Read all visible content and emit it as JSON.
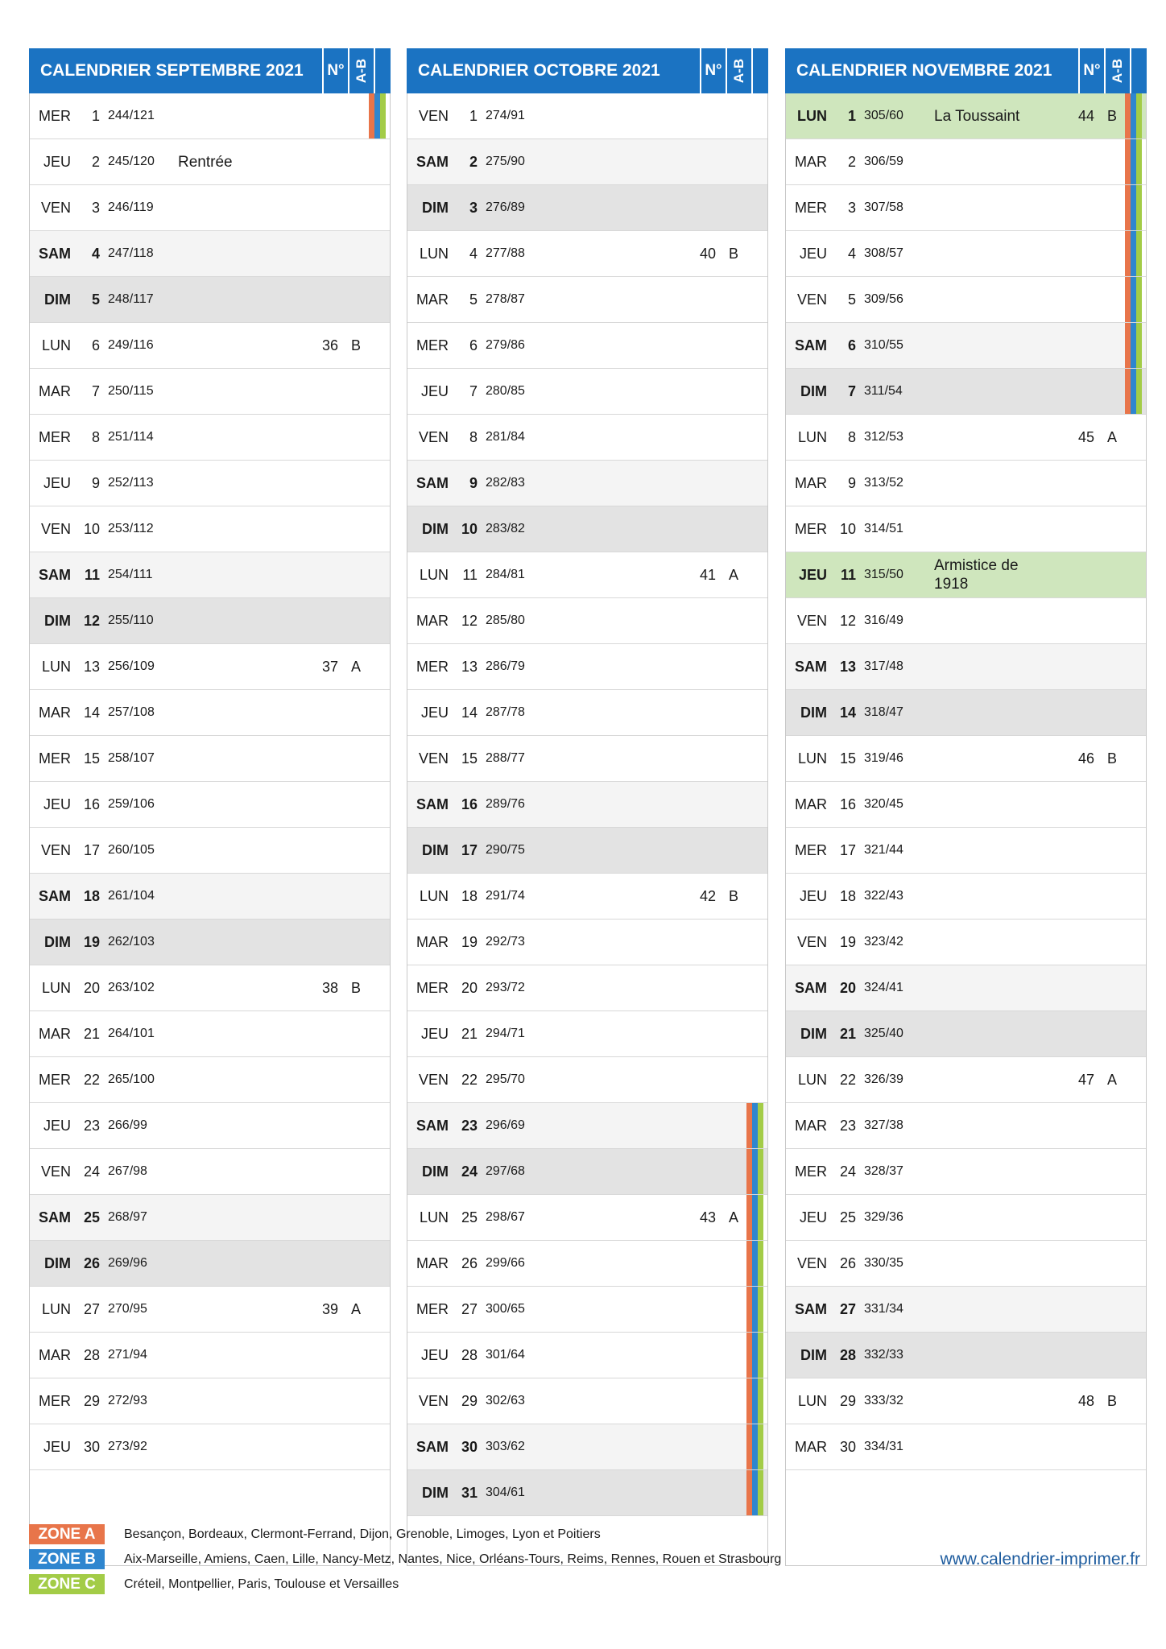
{
  "header_n": "N°",
  "header_ab": "A-B",
  "colors": {
    "zone_a": "#e8754a",
    "zone_b": "#2f86cf",
    "zone_c": "#a3cc47",
    "header_bg": "#1b73c2"
  },
  "months": [
    {
      "title": "CALENDRIER SEPTEMBRE 2021",
      "days": [
        {
          "dn": "MER",
          "d": "1",
          "doy": "244/121",
          "ev": "",
          "wn": "",
          "ab": "",
          "zones": [
            "a",
            "b",
            "c"
          ]
        },
        {
          "dn": "JEU",
          "d": "2",
          "doy": "245/120",
          "ev": "Rentrée",
          "wn": "",
          "ab": ""
        },
        {
          "dn": "VEN",
          "d": "3",
          "doy": "246/119",
          "ev": "",
          "wn": "",
          "ab": ""
        },
        {
          "dn": "SAM",
          "d": "4",
          "doy": "247/118",
          "ev": "",
          "wn": "",
          "ab": ""
        },
        {
          "dn": "DIM",
          "d": "5",
          "doy": "248/117",
          "ev": "",
          "wn": "",
          "ab": ""
        },
        {
          "dn": "LUN",
          "d": "6",
          "doy": "249/116",
          "ev": "",
          "wn": "36",
          "ab": "B"
        },
        {
          "dn": "MAR",
          "d": "7",
          "doy": "250/115",
          "ev": "",
          "wn": "",
          "ab": ""
        },
        {
          "dn": "MER",
          "d": "8",
          "doy": "251/114",
          "ev": "",
          "wn": "",
          "ab": ""
        },
        {
          "dn": "JEU",
          "d": "9",
          "doy": "252/113",
          "ev": "",
          "wn": "",
          "ab": ""
        },
        {
          "dn": "VEN",
          "d": "10",
          "doy": "253/112",
          "ev": "",
          "wn": "",
          "ab": ""
        },
        {
          "dn": "SAM",
          "d": "11",
          "doy": "254/111",
          "ev": "",
          "wn": "",
          "ab": ""
        },
        {
          "dn": "DIM",
          "d": "12",
          "doy": "255/110",
          "ev": "",
          "wn": "",
          "ab": ""
        },
        {
          "dn": "LUN",
          "d": "13",
          "doy": "256/109",
          "ev": "",
          "wn": "37",
          "ab": "A"
        },
        {
          "dn": "MAR",
          "d": "14",
          "doy": "257/108",
          "ev": "",
          "wn": "",
          "ab": ""
        },
        {
          "dn": "MER",
          "d": "15",
          "doy": "258/107",
          "ev": "",
          "wn": "",
          "ab": ""
        },
        {
          "dn": "JEU",
          "d": "16",
          "doy": "259/106",
          "ev": "",
          "wn": "",
          "ab": ""
        },
        {
          "dn": "VEN",
          "d": "17",
          "doy": "260/105",
          "ev": "",
          "wn": "",
          "ab": ""
        },
        {
          "dn": "SAM",
          "d": "18",
          "doy": "261/104",
          "ev": "",
          "wn": "",
          "ab": ""
        },
        {
          "dn": "DIM",
          "d": "19",
          "doy": "262/103",
          "ev": "",
          "wn": "",
          "ab": ""
        },
        {
          "dn": "LUN",
          "d": "20",
          "doy": "263/102",
          "ev": "",
          "wn": "38",
          "ab": "B"
        },
        {
          "dn": "MAR",
          "d": "21",
          "doy": "264/101",
          "ev": "",
          "wn": "",
          "ab": ""
        },
        {
          "dn": "MER",
          "d": "22",
          "doy": "265/100",
          "ev": "",
          "wn": "",
          "ab": ""
        },
        {
          "dn": "JEU",
          "d": "23",
          "doy": "266/99",
          "ev": "",
          "wn": "",
          "ab": ""
        },
        {
          "dn": "VEN",
          "d": "24",
          "doy": "267/98",
          "ev": "",
          "wn": "",
          "ab": ""
        },
        {
          "dn": "SAM",
          "d": "25",
          "doy": "268/97",
          "ev": "",
          "wn": "",
          "ab": ""
        },
        {
          "dn": "DIM",
          "d": "26",
          "doy": "269/96",
          "ev": "",
          "wn": "",
          "ab": ""
        },
        {
          "dn": "LUN",
          "d": "27",
          "doy": "270/95",
          "ev": "",
          "wn": "39",
          "ab": "A"
        },
        {
          "dn": "MAR",
          "d": "28",
          "doy": "271/94",
          "ev": "",
          "wn": "",
          "ab": ""
        },
        {
          "dn": "MER",
          "d": "29",
          "doy": "272/93",
          "ev": "",
          "wn": "",
          "ab": ""
        },
        {
          "dn": "JEU",
          "d": "30",
          "doy": "273/92",
          "ev": "",
          "wn": "",
          "ab": ""
        }
      ]
    },
    {
      "title": "CALENDRIER OCTOBRE 2021",
      "days": [
        {
          "dn": "VEN",
          "d": "1",
          "doy": "274/91",
          "ev": "",
          "wn": "",
          "ab": ""
        },
        {
          "dn": "SAM",
          "d": "2",
          "doy": "275/90",
          "ev": "",
          "wn": "",
          "ab": ""
        },
        {
          "dn": "DIM",
          "d": "3",
          "doy": "276/89",
          "ev": "",
          "wn": "",
          "ab": ""
        },
        {
          "dn": "LUN",
          "d": "4",
          "doy": "277/88",
          "ev": "",
          "wn": "40",
          "ab": "B"
        },
        {
          "dn": "MAR",
          "d": "5",
          "doy": "278/87",
          "ev": "",
          "wn": "",
          "ab": ""
        },
        {
          "dn": "MER",
          "d": "6",
          "doy": "279/86",
          "ev": "",
          "wn": "",
          "ab": ""
        },
        {
          "dn": "JEU",
          "d": "7",
          "doy": "280/85",
          "ev": "",
          "wn": "",
          "ab": ""
        },
        {
          "dn": "VEN",
          "d": "8",
          "doy": "281/84",
          "ev": "",
          "wn": "",
          "ab": ""
        },
        {
          "dn": "SAM",
          "d": "9",
          "doy": "282/83",
          "ev": "",
          "wn": "",
          "ab": ""
        },
        {
          "dn": "DIM",
          "d": "10",
          "doy": "283/82",
          "ev": "",
          "wn": "",
          "ab": ""
        },
        {
          "dn": "LUN",
          "d": "11",
          "doy": "284/81",
          "ev": "",
          "wn": "41",
          "ab": "A"
        },
        {
          "dn": "MAR",
          "d": "12",
          "doy": "285/80",
          "ev": "",
          "wn": "",
          "ab": ""
        },
        {
          "dn": "MER",
          "d": "13",
          "doy": "286/79",
          "ev": "",
          "wn": "",
          "ab": ""
        },
        {
          "dn": "JEU",
          "d": "14",
          "doy": "287/78",
          "ev": "",
          "wn": "",
          "ab": ""
        },
        {
          "dn": "VEN",
          "d": "15",
          "doy": "288/77",
          "ev": "",
          "wn": "",
          "ab": ""
        },
        {
          "dn": "SAM",
          "d": "16",
          "doy": "289/76",
          "ev": "",
          "wn": "",
          "ab": ""
        },
        {
          "dn": "DIM",
          "d": "17",
          "doy": "290/75",
          "ev": "",
          "wn": "",
          "ab": ""
        },
        {
          "dn": "LUN",
          "d": "18",
          "doy": "291/74",
          "ev": "",
          "wn": "42",
          "ab": "B"
        },
        {
          "dn": "MAR",
          "d": "19",
          "doy": "292/73",
          "ev": "",
          "wn": "",
          "ab": ""
        },
        {
          "dn": "MER",
          "d": "20",
          "doy": "293/72",
          "ev": "",
          "wn": "",
          "ab": ""
        },
        {
          "dn": "JEU",
          "d": "21",
          "doy": "294/71",
          "ev": "",
          "wn": "",
          "ab": ""
        },
        {
          "dn": "VEN",
          "d": "22",
          "doy": "295/70",
          "ev": "",
          "wn": "",
          "ab": ""
        },
        {
          "dn": "SAM",
          "d": "23",
          "doy": "296/69",
          "ev": "",
          "wn": "",
          "ab": "",
          "zones": [
            "a",
            "b",
            "c"
          ]
        },
        {
          "dn": "DIM",
          "d": "24",
          "doy": "297/68",
          "ev": "",
          "wn": "",
          "ab": "",
          "zones": [
            "a",
            "b",
            "c"
          ]
        },
        {
          "dn": "LUN",
          "d": "25",
          "doy": "298/67",
          "ev": "",
          "wn": "43",
          "ab": "A",
          "zones": [
            "a",
            "b",
            "c"
          ]
        },
        {
          "dn": "MAR",
          "d": "26",
          "doy": "299/66",
          "ev": "",
          "wn": "",
          "ab": "",
          "zones": [
            "a",
            "b",
            "c"
          ]
        },
        {
          "dn": "MER",
          "d": "27",
          "doy": "300/65",
          "ev": "",
          "wn": "",
          "ab": "",
          "zones": [
            "a",
            "b",
            "c"
          ]
        },
        {
          "dn": "JEU",
          "d": "28",
          "doy": "301/64",
          "ev": "",
          "wn": "",
          "ab": "",
          "zones": [
            "a",
            "b",
            "c"
          ]
        },
        {
          "dn": "VEN",
          "d": "29",
          "doy": "302/63",
          "ev": "",
          "wn": "",
          "ab": "",
          "zones": [
            "a",
            "b",
            "c"
          ]
        },
        {
          "dn": "SAM",
          "d": "30",
          "doy": "303/62",
          "ev": "",
          "wn": "",
          "ab": "",
          "zones": [
            "a",
            "b",
            "c"
          ]
        },
        {
          "dn": "DIM",
          "d": "31",
          "doy": "304/61",
          "ev": "",
          "wn": "",
          "ab": "",
          "zones": [
            "a",
            "b",
            "c"
          ]
        }
      ]
    },
    {
      "title": "CALENDRIER NOVEMBRE 2021",
      "days": [
        {
          "dn": "LUN",
          "d": "1",
          "doy": "305/60",
          "ev": "La Toussaint",
          "wn": "44",
          "ab": "B",
          "holiday": true,
          "zones": [
            "a",
            "b",
            "c"
          ]
        },
        {
          "dn": "MAR",
          "d": "2",
          "doy": "306/59",
          "ev": "",
          "wn": "",
          "ab": "",
          "zones": [
            "a",
            "b",
            "c"
          ]
        },
        {
          "dn": "MER",
          "d": "3",
          "doy": "307/58",
          "ev": "",
          "wn": "",
          "ab": "",
          "zones": [
            "a",
            "b",
            "c"
          ]
        },
        {
          "dn": "JEU",
          "d": "4",
          "doy": "308/57",
          "ev": "",
          "wn": "",
          "ab": "",
          "zones": [
            "a",
            "b",
            "c"
          ]
        },
        {
          "dn": "VEN",
          "d": "5",
          "doy": "309/56",
          "ev": "",
          "wn": "",
          "ab": "",
          "zones": [
            "a",
            "b",
            "c"
          ]
        },
        {
          "dn": "SAM",
          "d": "6",
          "doy": "310/55",
          "ev": "",
          "wn": "",
          "ab": "",
          "zones": [
            "a",
            "b",
            "c"
          ]
        },
        {
          "dn": "DIM",
          "d": "7",
          "doy": "311/54",
          "ev": "",
          "wn": "",
          "ab": "",
          "zones": [
            "a",
            "b",
            "c"
          ]
        },
        {
          "dn": "LUN",
          "d": "8",
          "doy": "312/53",
          "ev": "",
          "wn": "45",
          "ab": "A"
        },
        {
          "dn": "MAR",
          "d": "9",
          "doy": "313/52",
          "ev": "",
          "wn": "",
          "ab": ""
        },
        {
          "dn": "MER",
          "d": "10",
          "doy": "314/51",
          "ev": "",
          "wn": "",
          "ab": ""
        },
        {
          "dn": "JEU",
          "d": "11",
          "doy": "315/50",
          "ev": "Armistice de 1918",
          "wn": "",
          "ab": "",
          "holiday": true
        },
        {
          "dn": "VEN",
          "d": "12",
          "doy": "316/49",
          "ev": "",
          "wn": "",
          "ab": ""
        },
        {
          "dn": "SAM",
          "d": "13",
          "doy": "317/48",
          "ev": "",
          "wn": "",
          "ab": ""
        },
        {
          "dn": "DIM",
          "d": "14",
          "doy": "318/47",
          "ev": "",
          "wn": "",
          "ab": ""
        },
        {
          "dn": "LUN",
          "d": "15",
          "doy": "319/46",
          "ev": "",
          "wn": "46",
          "ab": "B"
        },
        {
          "dn": "MAR",
          "d": "16",
          "doy": "320/45",
          "ev": "",
          "wn": "",
          "ab": ""
        },
        {
          "dn": "MER",
          "d": "17",
          "doy": "321/44",
          "ev": "",
          "wn": "",
          "ab": ""
        },
        {
          "dn": "JEU",
          "d": "18",
          "doy": "322/43",
          "ev": "",
          "wn": "",
          "ab": ""
        },
        {
          "dn": "VEN",
          "d": "19",
          "doy": "323/42",
          "ev": "",
          "wn": "",
          "ab": ""
        },
        {
          "dn": "SAM",
          "d": "20",
          "doy": "324/41",
          "ev": "",
          "wn": "",
          "ab": ""
        },
        {
          "dn": "DIM",
          "d": "21",
          "doy": "325/40",
          "ev": "",
          "wn": "",
          "ab": ""
        },
        {
          "dn": "LUN",
          "d": "22",
          "doy": "326/39",
          "ev": "",
          "wn": "47",
          "ab": "A"
        },
        {
          "dn": "MAR",
          "d": "23",
          "doy": "327/38",
          "ev": "",
          "wn": "",
          "ab": ""
        },
        {
          "dn": "MER",
          "d": "24",
          "doy": "328/37",
          "ev": "",
          "wn": "",
          "ab": ""
        },
        {
          "dn": "JEU",
          "d": "25",
          "doy": "329/36",
          "ev": "",
          "wn": "",
          "ab": ""
        },
        {
          "dn": "VEN",
          "d": "26",
          "doy": "330/35",
          "ev": "",
          "wn": "",
          "ab": ""
        },
        {
          "dn": "SAM",
          "d": "27",
          "doy": "331/34",
          "ev": "",
          "wn": "",
          "ab": ""
        },
        {
          "dn": "DIM",
          "d": "28",
          "doy": "332/33",
          "ev": "",
          "wn": "",
          "ab": ""
        },
        {
          "dn": "LUN",
          "d": "29",
          "doy": "333/32",
          "ev": "",
          "wn": "48",
          "ab": "B"
        },
        {
          "dn": "MAR",
          "d": "30",
          "doy": "334/31",
          "ev": "",
          "wn": "",
          "ab": ""
        }
      ]
    }
  ],
  "legend": [
    {
      "label": "ZONE A",
      "zone": "a",
      "text": "Besançon, Bordeaux, Clermont-Ferrand, Dijon, Grenoble, Limoges, Lyon et Poitiers"
    },
    {
      "label": "ZONE B",
      "zone": "b",
      "text": "Aix-Marseille, Amiens, Caen, Lille, Nancy-Metz, Nantes, Nice, Orléans-Tours, Reims, Rennes, Rouen et Strasbourg"
    },
    {
      "label": "ZONE C",
      "zone": "c",
      "text": "Créteil, Montpellier, Paris, Toulouse et Versailles"
    }
  ],
  "website": "www.calendrier-imprimer.fr"
}
